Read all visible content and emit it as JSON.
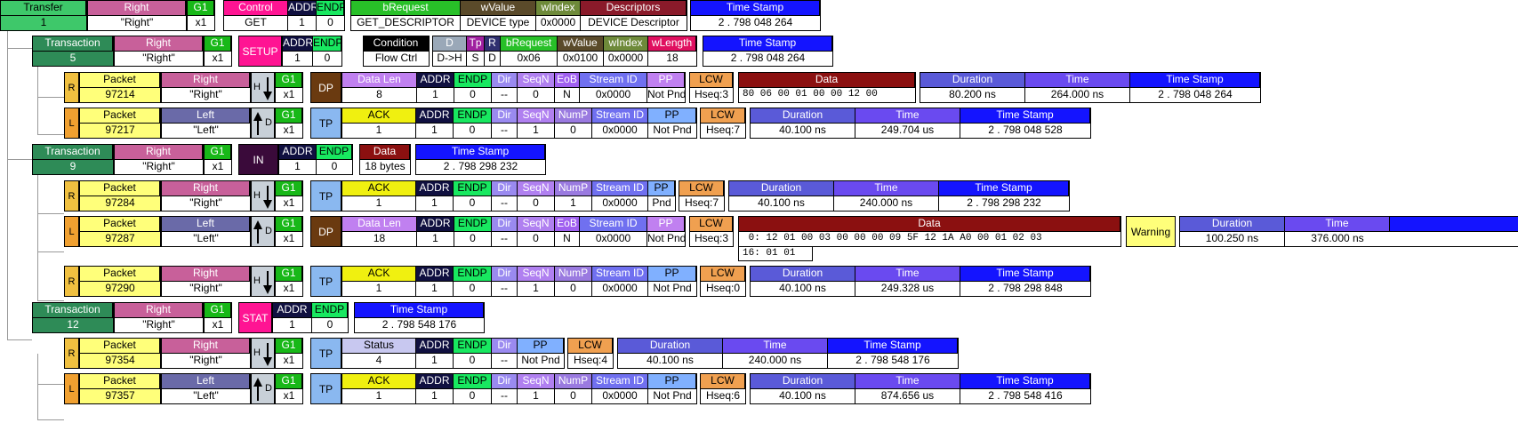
{
  "transfer": {
    "label": "Transfer",
    "id": "1",
    "dir_h": "Right",
    "dir_v": "\"Right\"",
    "g1_h": "G1",
    "g1_v": "x1",
    "control_h": "Control",
    "control_v": "GET",
    "addr_h": "ADDR",
    "addr_v": "1",
    "endp_h": "ENDP",
    "endp_v": "0",
    "breq_h": "bRequest",
    "breq_v": "GET_DESCRIPTOR",
    "wval_h": "wValue",
    "wval_v": "DEVICE type",
    "widx_h": "wIndex",
    "widx_v": "0x0000",
    "desc_h": "Descriptors",
    "desc_v": "DEVICE Descriptor",
    "ts_h": "Time Stamp",
    "ts_v": "2 . 798 048 264"
  },
  "trans5": {
    "label": "Transaction",
    "id": "5",
    "dir_h": "Right",
    "dir_v": "\"Right\"",
    "g1_h": "G1",
    "g1_v": "x1",
    "setup": "SETUP",
    "addr_h": "ADDR",
    "addr_v": "1",
    "endp_h": "ENDP",
    "endp_v": "0",
    "cond_h": "Condition",
    "cond_v": "Flow Ctrl",
    "d_h": "D",
    "d_v": "D->H",
    "tp_h": "Tp",
    "tp_v": "S",
    "r_h": "R",
    "r_v": "D",
    "breq_h": "bRequest",
    "breq_v": "0x06",
    "wval_h": "wValue",
    "wval_v": "0x0100",
    "widx_h": "wIndex",
    "widx_v": "0x0000",
    "wlen_h": "wLength",
    "wlen_v": "18",
    "ts_h": "Time Stamp",
    "ts_v": "2 . 798 048 264"
  },
  "p97214": {
    "side": "R",
    "label": "Packet",
    "id": "97214",
    "dir_h": "Right",
    "dir_v": "\"Right\"",
    "hd": "H",
    "g1_h": "G1",
    "g1_v": "x1",
    "pid": "DP",
    "dlen_h": "Data Len",
    "dlen_v": "8",
    "addr_h": "ADDR",
    "addr_v": "1",
    "endp_h": "ENDP",
    "endp_v": "0",
    "dirc_h": "Dir",
    "dirc_v": "--",
    "seqn_h": "SeqN",
    "seqn_v": "0",
    "eob_h": "EoB",
    "eob_v": "N",
    "sid_h": "Stream ID",
    "sid_v": "0x0000",
    "pp_h": "PP",
    "pp_v": "Not Pnd",
    "lcw_h": "LCW",
    "lcw_v": "Hseq:3",
    "data_h": "Data",
    "data_v": "80 06 00 01 00 00 12 00",
    "dur_h": "Duration",
    "dur_v": "80.200 ns",
    "time_h": "Time",
    "time_v": "264.000 ns",
    "ts_h": "Time Stamp",
    "ts_v": "2 . 798 048 264"
  },
  "p97217": {
    "side": "L",
    "label": "Packet",
    "id": "97217",
    "dir_h": "Left",
    "dir_v": "\"Left\"",
    "hd": "D",
    "g1_h": "G1",
    "g1_v": "x1",
    "pid": "TP",
    "ack_h": "ACK",
    "ack_v": "1",
    "addr_h": "ADDR",
    "addr_v": "1",
    "endp_h": "ENDP",
    "endp_v": "0",
    "dirc_h": "Dir",
    "dirc_v": "--",
    "seqn_h": "SeqN",
    "seqn_v": "1",
    "nump_h": "NumP",
    "nump_v": "0",
    "sid_h": "Stream ID",
    "sid_v": "0x0000",
    "pp_h": "PP",
    "pp_v": "Not Pnd",
    "lcw_h": "LCW",
    "lcw_v": "Hseq:7",
    "dur_h": "Duration",
    "dur_v": "40.100 ns",
    "time_h": "Time",
    "time_v": "249.704 us",
    "ts_h": "Time Stamp",
    "ts_v": "2 . 798 048 528"
  },
  "trans9": {
    "label": "Transaction",
    "id": "9",
    "dir_h": "Right",
    "dir_v": "\"Right\"",
    "g1_h": "G1",
    "g1_v": "x1",
    "pid": "IN",
    "addr_h": "ADDR",
    "addr_v": "1",
    "endp_h": "ENDP",
    "endp_v": "0",
    "data_h": "Data",
    "data_v": "18 bytes",
    "ts_h": "Time Stamp",
    "ts_v": "2 . 798 298 232"
  },
  "p97284": {
    "side": "R",
    "label": "Packet",
    "id": "97284",
    "dir_h": "Right",
    "dir_v": "\"Right\"",
    "hd": "H",
    "g1_h": "G1",
    "g1_v": "x1",
    "pid": "TP",
    "ack_h": "ACK",
    "ack_v": "1",
    "addr_h": "ADDR",
    "addr_v": "1",
    "endp_h": "ENDP",
    "endp_v": "0",
    "dirc_h": "Dir",
    "dirc_v": "--",
    "seqn_h": "SeqN",
    "seqn_v": "0",
    "nump_h": "NumP",
    "nump_v": "1",
    "sid_h": "Stream ID",
    "sid_v": "0x0000",
    "pp_h": "PP",
    "pp_v": "Pnd",
    "lcw_h": "LCW",
    "lcw_v": "Hseq:7",
    "dur_h": "Duration",
    "dur_v": "40.100 ns",
    "time_h": "Time",
    "time_v": "240.000 ns",
    "ts_h": "Time Stamp",
    "ts_v": "2 . 798 298 232"
  },
  "p97287": {
    "side": "L",
    "label": "Packet",
    "id": "97287",
    "dir_h": "Left",
    "dir_v": "\"Left\"",
    "hd": "D",
    "g1_h": "G1",
    "g1_v": "x1",
    "pid": "DP",
    "dlen_h": "Data Len",
    "dlen_v": "18",
    "addr_h": "ADDR",
    "addr_v": "1",
    "endp_h": "ENDP",
    "endp_v": "0",
    "dirc_h": "Dir",
    "dirc_v": "--",
    "seqn_h": "SeqN",
    "seqn_v": "0",
    "eob_h": "EoB",
    "eob_v": "N",
    "sid_h": "Stream ID",
    "sid_v": "0x0000",
    "pp_h": "PP",
    "pp_v": "Not Pnd",
    "lcw_h": "LCW",
    "lcw_v": "Hseq:3",
    "data_h": "Data",
    "data_v1": " 0: 12 01 00 03 00 00 00 09 5F 12 1A A0 00 01 02 03",
    "data_v2": "16: 01 01",
    "warn": "Warning",
    "dur_h": "Duration",
    "dur_v": "100.250 ns",
    "time_h": "Time",
    "time_v": "376.000 ns"
  },
  "p97290": {
    "side": "R",
    "label": "Packet",
    "id": "97290",
    "dir_h": "Right",
    "dir_v": "\"Right\"",
    "hd": "H",
    "g1_h": "G1",
    "g1_v": "x1",
    "pid": "TP",
    "ack_h": "ACK",
    "ack_v": "1",
    "addr_h": "ADDR",
    "addr_v": "1",
    "endp_h": "ENDP",
    "endp_v": "0",
    "dirc_h": "Dir",
    "dirc_v": "--",
    "seqn_h": "SeqN",
    "seqn_v": "1",
    "nump_h": "NumP",
    "nump_v": "0",
    "sid_h": "Stream ID",
    "sid_v": "0x0000",
    "pp_h": "PP",
    "pp_v": "Not Pnd",
    "lcw_h": "LCW",
    "lcw_v": "Hseq:0",
    "dur_h": "Duration",
    "dur_v": "40.100 ns",
    "time_h": "Time",
    "time_v": "249.328 us",
    "ts_h": "Time Stamp",
    "ts_v": "2 . 798 298 848"
  },
  "trans12": {
    "label": "Transaction",
    "id": "12",
    "dir_h": "Right",
    "dir_v": "\"Right\"",
    "g1_h": "G1",
    "g1_v": "x1",
    "pid": "STAT",
    "addr_h": "ADDR",
    "addr_v": "1",
    "endp_h": "ENDP",
    "endp_v": "0",
    "ts_h": "Time Stamp",
    "ts_v": "2 . 798 548 176"
  },
  "p97354": {
    "side": "R",
    "label": "Packet",
    "id": "97354",
    "dir_h": "Right",
    "dir_v": "\"Right\"",
    "hd": "H",
    "g1_h": "G1",
    "g1_v": "x1",
    "pid": "TP",
    "status_h": "Status",
    "status_v": "4",
    "addr_h": "ADDR",
    "addr_v": "1",
    "endp_h": "ENDP",
    "endp_v": "0",
    "dirc_h": "Dir",
    "dirc_v": "--",
    "pp_h": "PP",
    "pp_v": "Not Pnd",
    "lcw_h": "LCW",
    "lcw_v": "Hseq:4",
    "dur_h": "Duration",
    "dur_v": "40.100 ns",
    "time_h": "Time",
    "time_v": "240.000 ns",
    "ts_h": "Time Stamp",
    "ts_v": "2 . 798 548 176"
  },
  "p97357": {
    "side": "L",
    "label": "Packet",
    "id": "97357",
    "dir_h": "Left",
    "dir_v": "\"Left\"",
    "hd": "D",
    "g1_h": "G1",
    "g1_v": "x1",
    "pid": "TP",
    "ack_h": "ACK",
    "ack_v": "1",
    "addr_h": "ADDR",
    "addr_v": "1",
    "endp_h": "ENDP",
    "endp_v": "0",
    "dirc_h": "Dir",
    "dirc_v": "--",
    "seqn_h": "SeqN",
    "seqn_v": "1",
    "nump_h": "NumP",
    "nump_v": "0",
    "sid_h": "Stream ID",
    "sid_v": "0x0000",
    "pp_h": "PP",
    "pp_v": "Not Pnd",
    "lcw_h": "LCW",
    "lcw_v": "Hseq:6",
    "dur_h": "Duration",
    "dur_v": "40.100 ns",
    "time_h": "Time",
    "time_v": "874.656 us",
    "ts_h": "Time Stamp",
    "ts_v": "2 . 798 548 416"
  },
  "colors": {
    "transfer": "#3ec86a",
    "transaction": "#2e8b57",
    "packet_label": "#ffff7a",
    "right": "#c8609a",
    "left": "#6a6aa8",
    "g1": "#18b818",
    "control": "#ff1493",
    "addr": "#101040",
    "endp": "#18e860",
    "brequest": "#28c028",
    "wvalue": "#5a4a2a",
    "windex": "#6e8a3a",
    "descriptors": "#8a1a2a",
    "timestamp": "#1414ff",
    "duration": "#5a5ad8",
    "time": "#6a4af0",
    "condition": "#000000",
    "d": "#9aa8b8",
    "tp": "#a020a0",
    "r": "#303070",
    "wlength": "#e01060",
    "dp": "#6a3a10",
    "tp_block": "#8ab8f0",
    "ack": "#f0f010",
    "dir": "#9a8af0",
    "seqn": "#b080f0",
    "nump": "#9a7ae0",
    "eob": "#a060f0",
    "stream": "#7070f0",
    "pp": "#80b0ff",
    "lcw": "#f0a050",
    "data_hdr": "#8b1010",
    "in_block": "#3a0a3a",
    "stat": "#ff1493",
    "status": "#c8c8f0",
    "warning": "#ffff7a",
    "datalen": "#c080f0"
  }
}
